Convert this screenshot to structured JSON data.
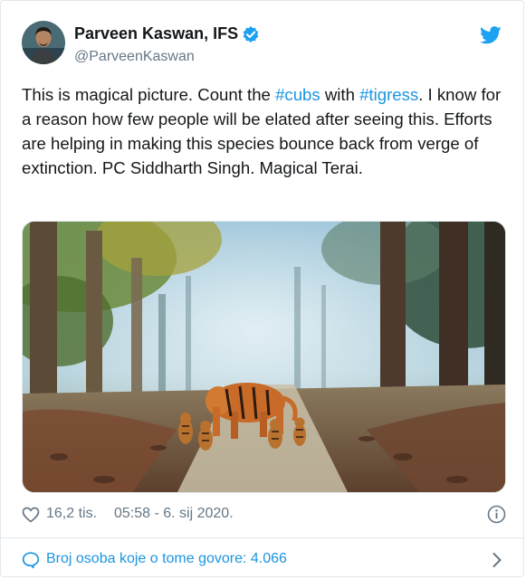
{
  "author": {
    "display_name": "Parveen Kaswan, IFS",
    "handle": "@ParveenKaswan"
  },
  "tweet": {
    "text_1": "This is magical picture. Count the ",
    "hashtag_1": "#cubs",
    "text_2": " with ",
    "hashtag_2": "#tigress",
    "text_3": ". I know for a reason how few people will be elated after seeing this. Efforts are helping in making this species bounce back from verge of extinction. PC Siddharth Singh. Magical Terai."
  },
  "stats": {
    "likes": "16,2 tis.",
    "timestamp": "05:58 - 6. sij 2020."
  },
  "conversation": {
    "label": "Broj osoba koje o tome govore: 4.066"
  },
  "icons": [
    "verified-badge-icon",
    "twitter-bird-icon",
    "heart-icon",
    "info-icon",
    "speech-bubble-icon",
    "chevron-right-icon"
  ],
  "colors": {
    "accent": "#1b95e0",
    "text": "#14171a",
    "muted": "#657786",
    "border": "#e1e8ed",
    "twitter_blue": "#1da1f2"
  }
}
